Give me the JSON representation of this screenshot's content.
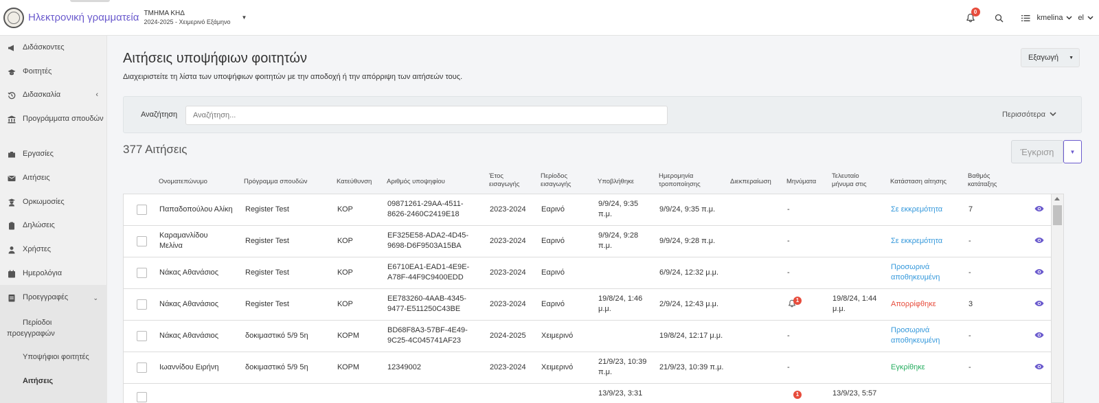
{
  "topbar": {
    "brand": "Ηλεκτρονική γραμματεία",
    "department": "ΤΜΗΜΑ ΚΗΔ",
    "period": "2024-2025 - Χειμερινό Εξάμηνο",
    "notifications_count": "0",
    "username": "kmelina",
    "language": "el"
  },
  "sidebar": {
    "items": [
      {
        "label": "Διδάσκοντες",
        "icon": "megaphone-icon"
      },
      {
        "label": "Φοιτητές",
        "icon": "graduation-cap-icon"
      },
      {
        "label": "Διδασκαλία",
        "icon": "history-icon"
      },
      {
        "label": "Προγράμματα σπουδών",
        "icon": "institution-icon"
      },
      {
        "label": "Εργασίες",
        "icon": "briefcase-icon"
      },
      {
        "label": "Αιτήσεις",
        "icon": "envelope-icon"
      },
      {
        "label": "Ορκωμοσίες",
        "icon": "graduate-icon"
      },
      {
        "label": "Δηλώσεις",
        "icon": "clipboard-icon"
      },
      {
        "label": "Χρήστες",
        "icon": "user-icon"
      },
      {
        "label": "Ημερολόγια",
        "icon": "calendar-icon"
      },
      {
        "label": "Προεγγραφές",
        "icon": "id-card-icon"
      }
    ],
    "subitems": [
      {
        "label": "Περίοδοι προεγγραφών"
      },
      {
        "label": "Υποψήφιοι φοιτητές"
      },
      {
        "label": "Αιτήσεις"
      }
    ]
  },
  "main": {
    "title": "Αιτήσεις υποψήφιων φοιτητών",
    "description": "Διαχειριστείτε τη λίστα των υποψήφιων φοιτητών με την αποδοχή ή την απόρριψη των αιτήσεών τους.",
    "export_label": "Εξαγωγή",
    "search_label": "Αναζήτηση",
    "search_placeholder": "Αναζήτηση...",
    "more_label": "Περισσότερα",
    "count_label": "377 Αιτήσεις",
    "approve_label": "Έγκριση"
  },
  "table": {
    "headers": [
      "Ονοματεπώνυμο",
      "Πρόγραμμα σπουδών",
      "Κατεύθυνση",
      "Αριθμός υποψηφίου",
      "Έτος εισαγωγής",
      "Περίοδος εισαγωγής",
      "Υποβλήθηκε",
      "Ημερομηνία τροποποίησης",
      "Διεκπεραίωση",
      "Μηνύματα",
      "Τελευταίο μήνυμα στις",
      "Κατάσταση αίτησης",
      "Βαθμός κατάταξης"
    ],
    "rows": [
      {
        "name": "Παπαδοπούλου Αλίκη",
        "program": "Register Test",
        "direction": "ΚΟΡ",
        "number": "09871261-29AA-4511-8626-2460C2419E18",
        "year": "2023-2024",
        "period": "Εαρινό",
        "submitted": "9/9/24, 9:35 π.μ.",
        "modified": "9/9/24, 9:35 π.μ.",
        "processing": "",
        "messages": "-",
        "messages_badge": "",
        "last_message": "",
        "status": "Σε εκκρεμότητα",
        "status_kind": "pending",
        "rank": "7"
      },
      {
        "name": "Καραμανλίδου Μελίνα",
        "program": "Register Test",
        "direction": "ΚΟΡ",
        "number": "EF325E58-ADA2-4D45-9698-D6F9503A15BA",
        "year": "2023-2024",
        "period": "Εαρινό",
        "submitted": "9/9/24, 9:28 π.μ.",
        "modified": "9/9/24, 9:28 π.μ.",
        "processing": "",
        "messages": "-",
        "messages_badge": "",
        "last_message": "",
        "status": "Σε εκκρεμότητα",
        "status_kind": "pending",
        "rank": "-"
      },
      {
        "name": "Νάκας Αθανάσιος",
        "program": "Register Test",
        "direction": "ΚΟΡ",
        "number": "E6710EA1-EAD1-4E9E-A78F-44F9C9400EDD",
        "year": "2023-2024",
        "period": "Εαρινό",
        "submitted": "",
        "modified": "6/9/24, 12:32 μ.μ.",
        "processing": "",
        "messages": "-",
        "messages_badge": "",
        "last_message": "",
        "status": "Προσωρινά αποθηκευμένη",
        "status_kind": "temp",
        "rank": "-"
      },
      {
        "name": "Νάκας Αθανάσιος",
        "program": "Register Test",
        "direction": "ΚΟΡ",
        "number": "EE783260-4AAB-4345-9477-E511250C43BE",
        "year": "2023-2024",
        "period": "Εαρινό",
        "submitted": "19/8/24, 1:46 μ.μ.",
        "modified": "2/9/24, 12:43 μ.μ.",
        "processing": "",
        "messages": "",
        "messages_badge": "1",
        "last_message": "19/8/24, 1:44 μ.μ.",
        "status": "Απορρίφθηκε",
        "status_kind": "rejected",
        "rank": "3"
      },
      {
        "name": "Νάκας Αθανάσιος",
        "program": "δοκιμαστικό 5/9 5η",
        "direction": "ΚΟΡΜ",
        "number": "BD68F8A3-57BF-4E49-9C25-4C045741AF23",
        "year": "2024-2025",
        "period": "Χειμερινό",
        "submitted": "",
        "modified": "19/8/24, 12:17 μ.μ.",
        "processing": "",
        "messages": "-",
        "messages_badge": "",
        "last_message": "",
        "status": "Προσωρινά αποθηκευμένη",
        "status_kind": "temp",
        "rank": "-"
      },
      {
        "name": "Ιωαννίδου Ειρήνη",
        "program": "δοκιμαστικό 5/9 5η",
        "direction": "ΚΟΡΜ",
        "number": "12349002",
        "year": "2023-2024",
        "period": "Χειμερινό",
        "submitted": "21/9/23, 10:39 π.μ.",
        "modified": "21/9/23, 10:39 π.μ.",
        "processing": "",
        "messages": "-",
        "messages_badge": "",
        "last_message": "",
        "status": "Εγκρίθηκε",
        "status_kind": "approved",
        "rank": "-"
      },
      {
        "name": "",
        "program": "",
        "direction": "",
        "number": "",
        "year": "",
        "period": "",
        "submitted": "13/9/23, 3:31",
        "modified": "",
        "processing": "",
        "messages": "",
        "messages_badge": "1",
        "last_message": "13/9/23, 5:57",
        "status": "",
        "status_kind": "",
        "rank": ""
      }
    ]
  },
  "colors": {
    "accent": "#6a5acd",
    "pending": "#3498db",
    "rejected": "#e74c3c",
    "approved": "#27ae60"
  }
}
